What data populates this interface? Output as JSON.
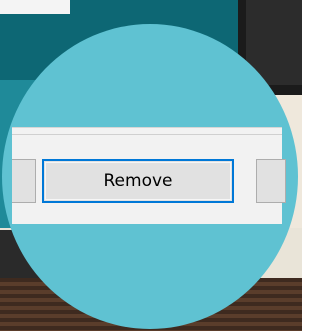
{
  "dialog": {
    "remove_label": "Remove",
    "left_button_label": "",
    "right_button_label": ""
  },
  "colors": {
    "lens": "#5fc2d2",
    "focus_border": "#0078d7",
    "button_face": "#e1e1e1"
  }
}
